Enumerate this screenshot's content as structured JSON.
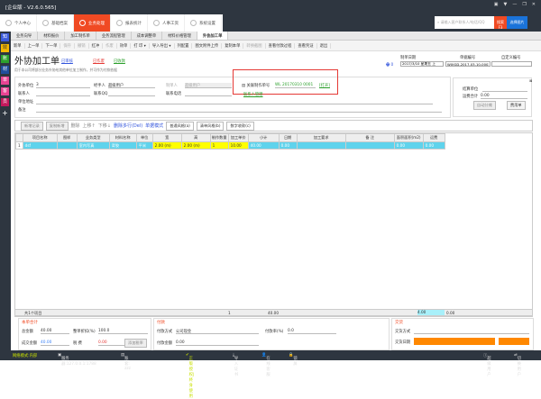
{
  "app": {
    "title": "[企业版 - V2.6.0.565]",
    "window_controls": [
      "▣",
      "▼",
      "—",
      "❐",
      "✕"
    ]
  },
  "nav": [
    {
      "label": "个人中心"
    },
    {
      "label": "基础档案"
    },
    {
      "label": "业务处理",
      "active": true
    },
    {
      "label": "报表统计"
    },
    {
      "label": "人事工资"
    },
    {
      "label": "系统设置"
    }
  ],
  "search": {
    "placeholder": "请输入客户联系人/电话/QQ",
    "button": "搜索 F3",
    "pic_button": "选择图片"
  },
  "sidebar": [
    {
      "label": "知",
      "color": "#3b5bdb"
    },
    {
      "label": "效",
      "color": "#f5b800"
    },
    {
      "label": "账",
      "color": "#2ca02c"
    },
    {
      "label": "材",
      "color": "#1f4e9c"
    },
    {
      "label": "单",
      "color": "#e84393"
    },
    {
      "label": "客",
      "color": "#e84393"
    },
    {
      "label": "员",
      "color": "#c2185b"
    },
    {
      "label": "+",
      "color": "#2e3640"
    }
  ],
  "tabs": [
    "业务向导",
    "材料报价",
    "加工制作单",
    "业务流程管理",
    "成本调整单",
    "材料价格管理",
    "外协加工单"
  ],
  "toolbar": [
    {
      "label": "新单"
    },
    {
      "label": "上一单"
    },
    {
      "label": "下一单"
    },
    {
      "label": "保存",
      "disabled": true
    },
    {
      "label": "撤销",
      "disabled": true
    },
    {
      "label": "红冲"
    },
    {
      "label": "作废",
      "disabled": true
    },
    {
      "label": "效单"
    },
    {
      "label": "打 印 ▾"
    },
    {
      "label": "导入导出 ▾"
    },
    {
      "label": "列配置"
    },
    {
      "label": "图文附件上传"
    },
    {
      "label": "复制本单"
    },
    {
      "label": "转换截图",
      "disabled": true
    },
    {
      "label": "查看付款过程"
    },
    {
      "label": "查看凭证"
    },
    {
      "label": "退出"
    }
  ],
  "page": {
    "title": "外协加工单",
    "status_links": [
      "已审核",
      "已作废",
      "已收款"
    ],
    "subtitle": "用于本公司将部分业务外协给其他单位加工制作，并可作为付款依据"
  },
  "header": {
    "print_count": "0",
    "date_label": "制单日期",
    "date": "2017/3/10 星期五 上",
    "billno_label": "单据编号",
    "billno": "WXJGD-2017-03-10-0002",
    "custom_label": "自定义编号",
    "custom": ""
  },
  "form": {
    "unit_label": "外协单位",
    "unit": "3",
    "handler_label": "经手人",
    "handler": "超级用户",
    "maker_label": "制单人",
    "maker": "超级用户",
    "contact_label": "联系人",
    "contact": "",
    "qq_label": "联系QQ",
    "qq": "",
    "phone_label": "联系电话",
    "phone": "",
    "address_label": "单位地址",
    "address": "",
    "note_label": "备注",
    "note": "",
    "related_label": "关联制作单号",
    "related": "WL 20170310 0001",
    "open_link": "[打开]",
    "bottom_link": "联系人管理"
  },
  "right": {
    "settle_label": "结算单位",
    "settle": "",
    "fee_label": "运费合计",
    "fee": "0.00",
    "auto_btn": "自动分摊",
    "fee_btn": "费用单"
  },
  "gridbar": {
    "add": "新增记录",
    "copy": "复制新增",
    "delete": "删除",
    "up": "上移↑",
    "down": "下移↓",
    "multi": "删除多行(Del)",
    "mode": "单据模式",
    "style1": "普通风格(a)",
    "style2": "清单风格(b)",
    "style3": "数字收款(c)"
  },
  "grid": {
    "columns": [
      "",
      "项目名称",
      "图样",
      "业务类型",
      "材料名称",
      "单位",
      "宽",
      "高",
      "制作数量",
      "加工单价",
      "小计",
      "日期",
      "加工要求",
      "备 注",
      "面积面积(m2)",
      "运费"
    ],
    "rows": [
      [
        "1",
        "dsf",
        "",
        "室内写真",
        "背胶",
        "平米",
        "2.00 (m)",
        "2.00 (m)",
        "1",
        "10.00",
        "40.00",
        "0.00",
        "",
        "",
        "0.00",
        "0.00"
      ]
    ]
  },
  "sum": {
    "count": "共1个项目",
    "qty": "1",
    "amount": "40.00",
    "area": "4.00",
    "fee": "0.00"
  },
  "bill_total": {
    "title": "本单合计",
    "total_label": "总金额",
    "total": "40.00",
    "discount_label": "整单折扣(%)",
    "discount": "100.0",
    "deal_label": "成交金额",
    "deal": "40.00",
    "tax_label": "税 费",
    "tax": "0.00",
    "tax_btn": "添加税率"
  },
  "payment": {
    "title": "付款",
    "method_label": "付款方式",
    "method": "公司现金",
    "amount_label": "付款金额",
    "amount": "0.00",
    "rate_label": "付款率(%)",
    "rate": "0.0"
  },
  "delivery": {
    "title": "交货",
    "method_label": "交货方式",
    "method": "",
    "date_label": "交货日期",
    "date": "",
    "accent": "#ff8800"
  },
  "status": {
    "network": "网络模式:内部",
    "server": "服务器:127.0.0.1:1788",
    "user": "账套: zzz",
    "auth": "正版授权|终身使用",
    "cert": "导入证书",
    "online": "在线客服",
    "lock": "锁屏",
    "super": "超级用户",
    "switch": "切换用户"
  }
}
